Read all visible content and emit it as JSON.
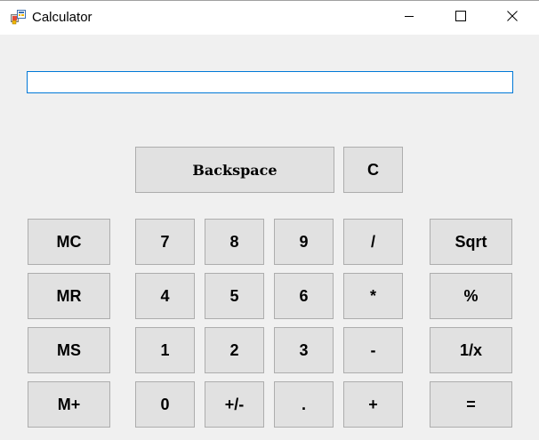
{
  "window": {
    "title": "Calculator",
    "icon": "calculator-app-icon",
    "controls": {
      "minimize": "minimize-icon",
      "maximize": "maximize-icon",
      "close": "close-icon"
    }
  },
  "display": {
    "value": "",
    "placeholder": ""
  },
  "buttons": {
    "backspace": "Backspace",
    "clear": "C",
    "mc": "MC",
    "mr": "MR",
    "ms": "MS",
    "mplus": "M+",
    "seven": "7",
    "eight": "8",
    "nine": "9",
    "divide": "/",
    "four": "4",
    "five": "5",
    "six": "6",
    "multiply": "*",
    "one": "1",
    "two": "2",
    "three": "3",
    "subtract": "-",
    "zero": "0",
    "negate": "+/-",
    "decimal": ".",
    "add": "+",
    "sqrt": "Sqrt",
    "percent": "%",
    "reciprocal": "1/x",
    "equals": "="
  },
  "colors": {
    "window_bg": "#f0f0f0",
    "titlebar_bg": "#ffffff",
    "button_bg": "#e1e1e1",
    "button_border": "#adadad",
    "input_focus_border": "#0078d7"
  }
}
